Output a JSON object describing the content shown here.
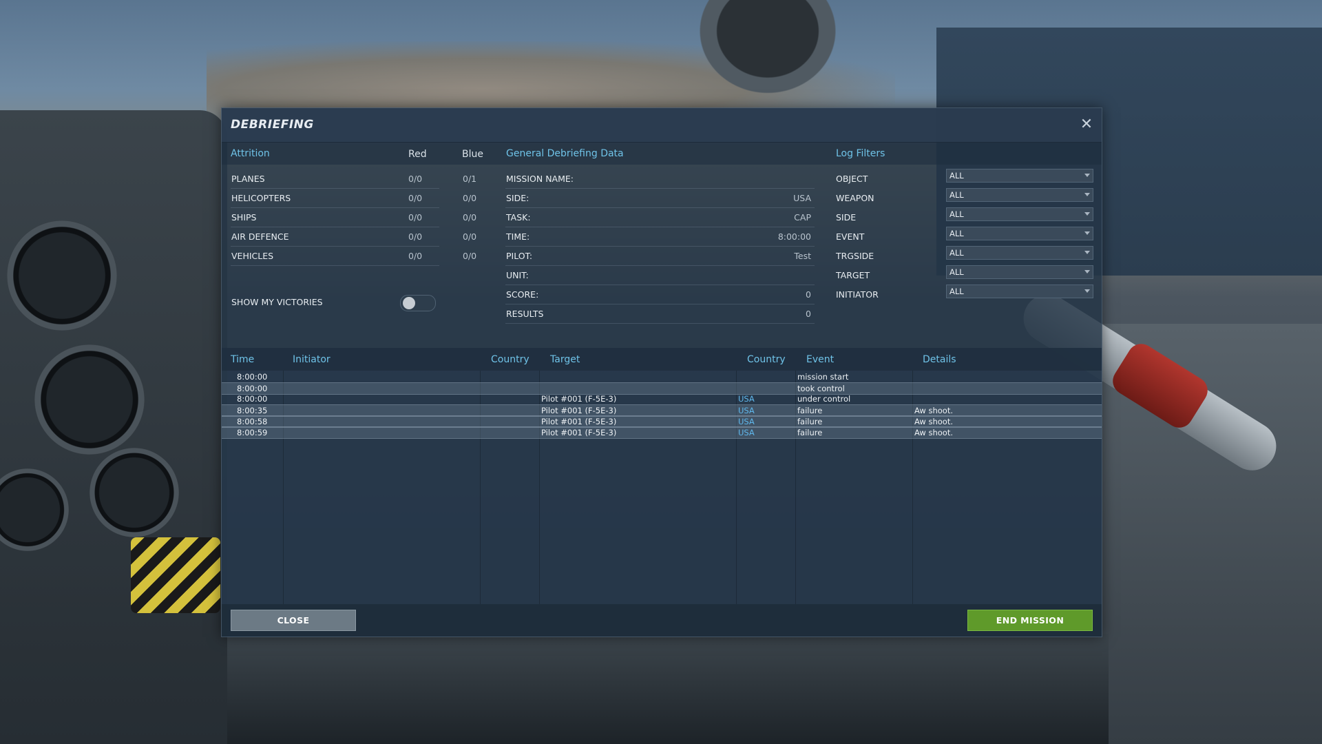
{
  "dialog": {
    "title": "DEBRIEFING",
    "close_icon": "close-icon"
  },
  "attrition": {
    "title": "Attrition",
    "col_red": "Red",
    "col_blue": "Blue",
    "rows": [
      {
        "label": "PLANES",
        "red": "0/0",
        "blue": "0/1"
      },
      {
        "label": "HELICOPTERS",
        "red": "0/0",
        "blue": "0/0"
      },
      {
        "label": "SHIPS",
        "red": "0/0",
        "blue": "0/0"
      },
      {
        "label": "AIR DEFENCE",
        "red": "0/0",
        "blue": "0/0"
      },
      {
        "label": "VEHICLES",
        "red": "0/0",
        "blue": "0/0"
      }
    ],
    "show_victories_label": "SHOW MY VICTORIES",
    "show_victories_on": false
  },
  "general": {
    "title": "General Debriefing Data",
    "rows": [
      {
        "label": "MISSION NAME:",
        "value": ""
      },
      {
        "label": "SIDE:",
        "value": "USA"
      },
      {
        "label": "TASK:",
        "value": "CAP"
      },
      {
        "label": "TIME:",
        "value": "8:00:00"
      },
      {
        "label": "PILOT:",
        "value": "Test"
      },
      {
        "label": "UNIT:",
        "value": ""
      },
      {
        "label": "SCORE:",
        "value": "0"
      },
      {
        "label": "RESULTS",
        "value": "0"
      }
    ]
  },
  "filters": {
    "title": "Log Filters",
    "rows": [
      {
        "label": "OBJECT",
        "value": "ALL"
      },
      {
        "label": "WEAPON",
        "value": "ALL"
      },
      {
        "label": "SIDE",
        "value": "ALL"
      },
      {
        "label": "EVENT",
        "value": "ALL"
      },
      {
        "label": "TRGSIDE",
        "value": "ALL"
      },
      {
        "label": "TARGET",
        "value": "ALL"
      },
      {
        "label": "INITIATOR",
        "value": "ALL"
      }
    ]
  },
  "log": {
    "columns": {
      "time": "Time",
      "initiator": "Initiator",
      "country": "Country",
      "target": "Target",
      "target_country": "Country",
      "event": "Event",
      "details": "Details"
    },
    "rows": [
      {
        "time": "8:00:00",
        "initiator": "",
        "country": "",
        "target": "",
        "target_country": "",
        "event": "mission start",
        "details": ""
      },
      {
        "time": "8:00:00",
        "initiator": "",
        "country": "",
        "target": "",
        "target_country": "",
        "event": "took control",
        "details": ""
      },
      {
        "time": "8:00:00",
        "initiator": "",
        "country": "",
        "target": "Pilot #001 (F-5E-3)",
        "target_country": "USA",
        "event": "under control",
        "details": ""
      },
      {
        "time": "8:00:35",
        "initiator": "",
        "country": "",
        "target": "Pilot #001 (F-5E-3)",
        "target_country": "USA",
        "event": "failure",
        "details": "Aw shoot."
      },
      {
        "time": "8:00:58",
        "initiator": "",
        "country": "",
        "target": "Pilot #001 (F-5E-3)",
        "target_country": "USA",
        "event": "failure",
        "details": "Aw shoot."
      },
      {
        "time": "8:00:59",
        "initiator": "",
        "country": "",
        "target": "Pilot #001 (F-5E-3)",
        "target_country": "USA",
        "event": "failure",
        "details": "Aw shoot."
      }
    ]
  },
  "footer": {
    "close_label": "CLOSE",
    "end_label": "END MISSION"
  },
  "colors": {
    "accent": "#6fc3e8",
    "end_button": "#5f9a2a",
    "close_button": "#6c7a85",
    "country_link": "#5fb7ec"
  }
}
